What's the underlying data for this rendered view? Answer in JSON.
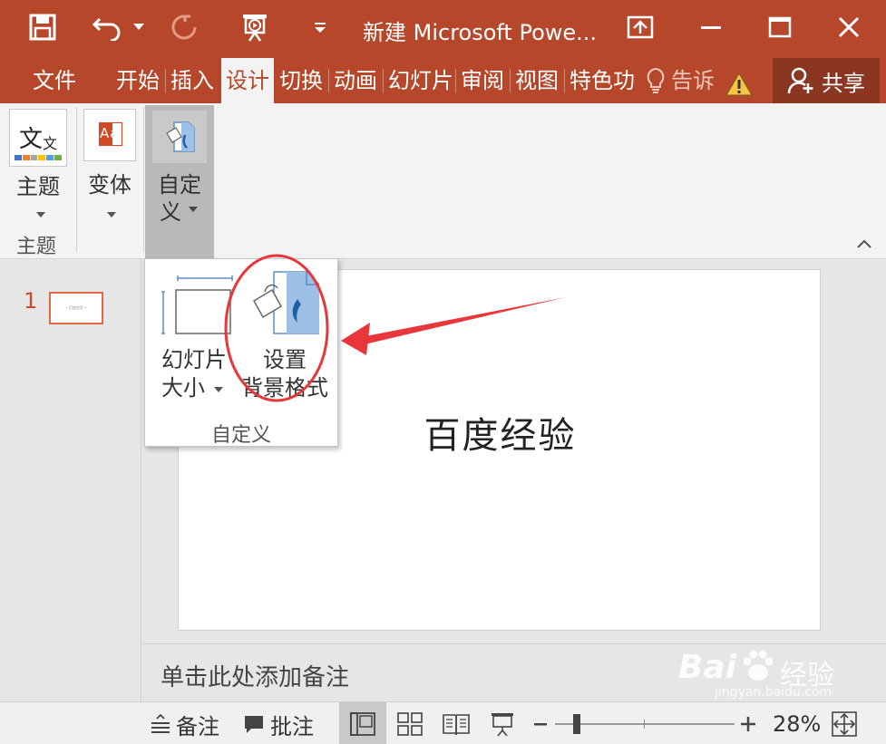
{
  "window": {
    "title": "新建 Microsoft Powe...",
    "accent": "#b7472a"
  },
  "quick_access": {
    "items": [
      "save-icon",
      "undo-icon",
      "redo-icon",
      "slideshow-start-icon",
      "customize-dropdown-icon"
    ]
  },
  "tabs": [
    {
      "label": "文件"
    },
    {
      "label": "开始"
    },
    {
      "label": "插入"
    },
    {
      "label": "设计",
      "active": true
    },
    {
      "label": "切换"
    },
    {
      "label": "动画"
    },
    {
      "label": "幻灯片"
    },
    {
      "label": "审阅"
    },
    {
      "label": "视图"
    },
    {
      "label": "特色功"
    }
  ],
  "tell_me": {
    "label": "告诉"
  },
  "share": {
    "label": "共享"
  },
  "ribbon": {
    "theme": {
      "tile_text_big": "文",
      "tile_text_small": "文",
      "label": "主题",
      "group_label": "主题"
    },
    "variant": {
      "tile_text": "Aa",
      "label": "变体"
    },
    "customize": {
      "label_line1": "自定",
      "label_line2": "义"
    }
  },
  "dropdown": {
    "slide_size_line1": "幻灯片",
    "slide_size_line2": "大小",
    "format_bg_line1": "设置",
    "format_bg_line2": "背景格式",
    "group_label": "自定义"
  },
  "thumbnails": [
    {
      "number": "1",
      "mini_text": "• 百度经验 •"
    }
  ],
  "slide": {
    "title": "百度经验"
  },
  "notes": {
    "placeholder": "单击此处添加备注"
  },
  "statusbar": {
    "notes_label": "备注",
    "comments_label": "批注",
    "zoom": "28%",
    "zoom_fraction": 0.28
  },
  "watermark": {
    "brand": "Bai",
    "brand_suffix": "经验",
    "url": "jingyan.baidu.com"
  }
}
